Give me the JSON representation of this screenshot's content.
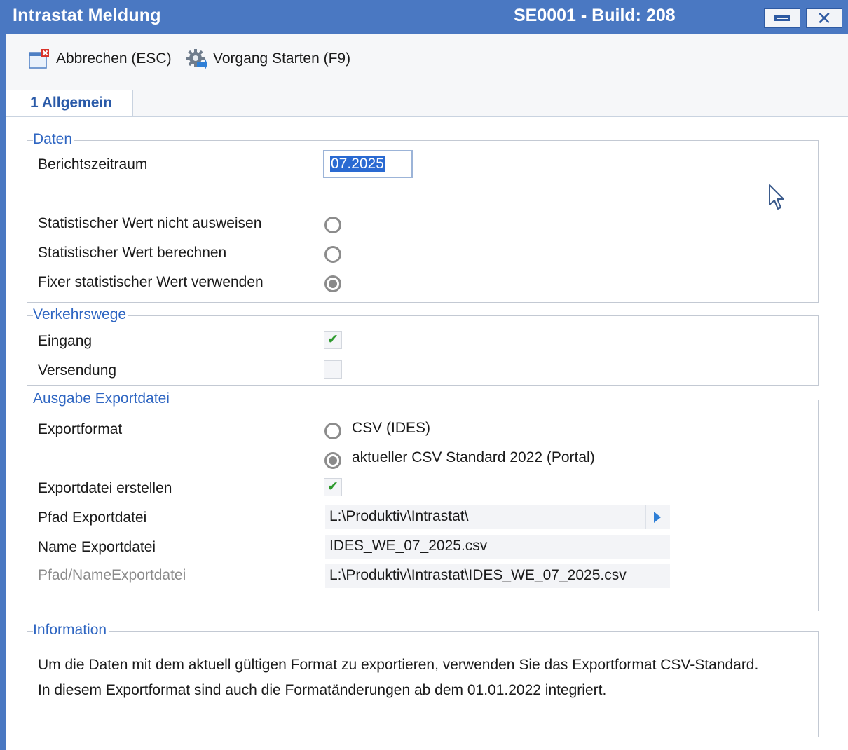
{
  "window": {
    "title": "Intrastat Meldung",
    "build": "SE0001 - Build: 208"
  },
  "toolbar": {
    "cancel_label": "Abbrechen (ESC)",
    "start_label": "Vorgang Starten (F9)"
  },
  "tabs": [
    {
      "label": "1 Allgemein",
      "active": true
    }
  ],
  "daten": {
    "legend": "Daten",
    "period_label": "Berichtszeitraum",
    "period_value": "07.2025",
    "options": [
      {
        "label": "Statistischer Wert nicht ausweisen",
        "selected": false
      },
      {
        "label": "Statistischer Wert berechnen",
        "selected": false
      },
      {
        "label": "Fixer statistischer Wert verwenden",
        "selected": true
      }
    ]
  },
  "verkehrswege": {
    "legend": "Verkehrswege",
    "eingang_label": "Eingang",
    "eingang_checked": true,
    "versendung_label": "Versendung",
    "versendung_checked": false
  },
  "export": {
    "legend": "Ausgabe Exportdatei",
    "format_label": "Exportformat",
    "formats": [
      {
        "label": "CSV (IDES)",
        "selected": false
      },
      {
        "label": "aktueller CSV Standard 2022 (Portal)",
        "selected": true
      }
    ],
    "create_label": "Exportdatei erstellen",
    "create_checked": true,
    "path_label": "Pfad Exportdatei",
    "path_value": "L:\\Produktiv\\Intrastat\\",
    "name_label": "Name Exportdatei",
    "name_value": "IDES_WE_07_2025.csv",
    "fullpath_label": "Pfad/NameExportdatei",
    "fullpath_value": "L:\\Produktiv\\Intrastat\\IDES_WE_07_2025.csv"
  },
  "information": {
    "legend": "Information",
    "line1": "Um die Daten mit dem aktuell gültigen Format zu exportieren, verwenden Sie das Exportformat CSV-Standard.",
    "line2": "In diesem Exportformat sind auch die Formatänderungen ab dem 01.01.2022 integriert."
  },
  "icons": {
    "cancel": "window-close-icon",
    "start": "gear-start-icon",
    "path_picker": "triangle-right-icon",
    "cursor": "mouse-pointer-icon"
  },
  "colors": {
    "titlebar": "#4a78c2",
    "legend": "#2f66c2",
    "selection": "#2a6ad2",
    "check": "#2e9a2e"
  }
}
